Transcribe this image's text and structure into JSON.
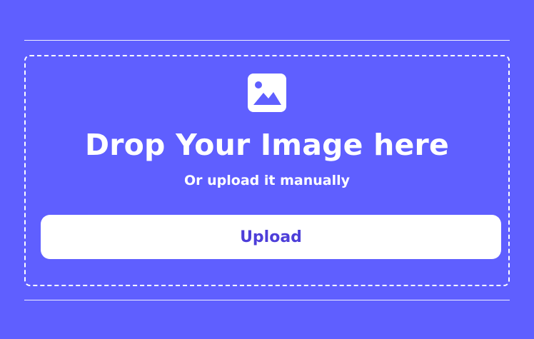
{
  "dropzone": {
    "icon": "image-icon",
    "title": "Drop Your Image here",
    "subtitle": "Or upload it manually",
    "upload_label": "Upload"
  },
  "colors": {
    "background": "#5f5fff",
    "foreground": "#ffffff",
    "button_text": "#4d3ed9"
  }
}
